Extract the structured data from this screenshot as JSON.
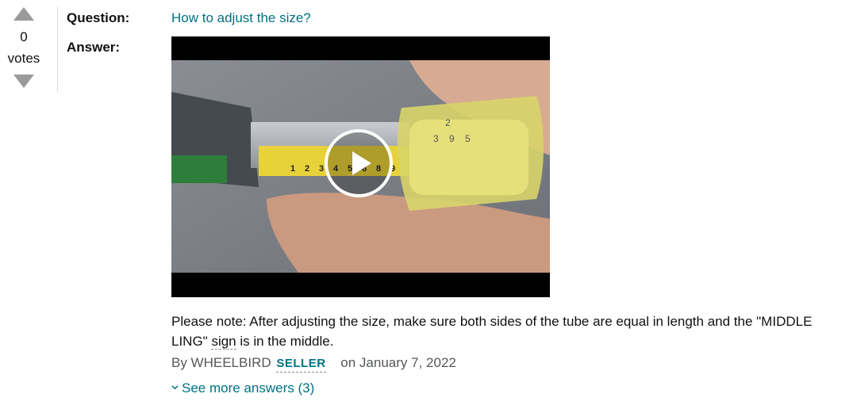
{
  "vote": {
    "count": "0",
    "label": "votes"
  },
  "question": {
    "label": "Question:",
    "text": "How to adjust the size?"
  },
  "answer": {
    "label": "Answer:",
    "text_part1": "Please note: After adjusting the size, make sure both sides of the tube are equal in length and the \"MIDDLE LING\" ",
    "text_underlined": "sign",
    "text_part2": " is in the middle.",
    "byline_prefix": "By WHEELBIRD",
    "seller_badge": "SELLER",
    "date": "on January 7, 2022"
  },
  "see_more": {
    "label": "See more answers (3)"
  },
  "video": {
    "icon": "play-icon",
    "tape_marks": [
      "1",
      "2",
      "3",
      "4",
      "5",
      "6",
      "8",
      "9",
      "2",
      "3",
      "9",
      "5"
    ]
  },
  "colors": {
    "link": "#007185",
    "vote_arrow": "#9a9a9a",
    "secondary_text": "#565959"
  }
}
